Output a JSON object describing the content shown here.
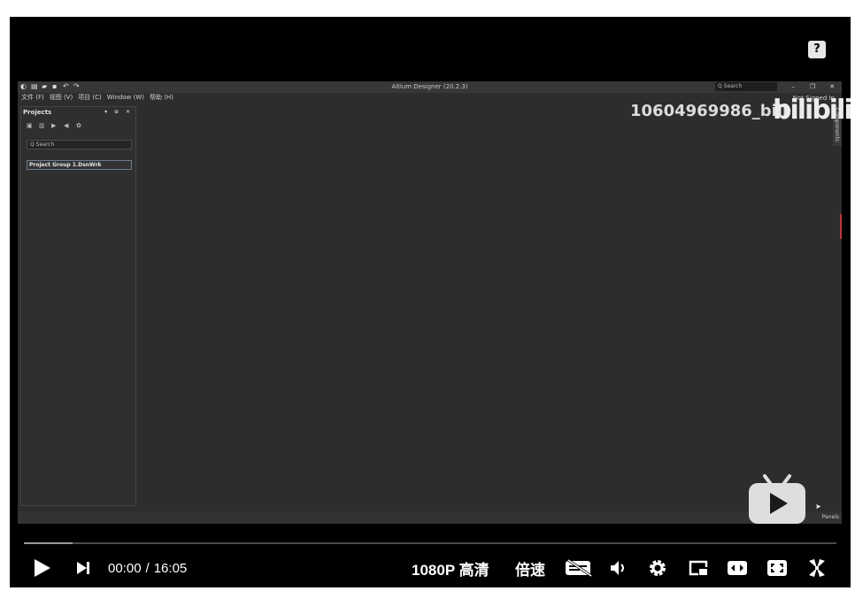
{
  "help_icon": "?",
  "altium": {
    "title": "Altium Designer (20.2.3)",
    "search_placeholder": "Q Search",
    "menu": [
      "文件 (F)",
      "视图 (V)",
      "项目 (C)",
      "Window (W)",
      "帮助 (H)"
    ],
    "signed_in": "Not Signed In",
    "projects_panel": {
      "title": "Projects",
      "search_placeholder": "Q Search",
      "item": "Project Group 1.DsnWrk"
    },
    "components_tab": "Components",
    "panels_button": "Panels"
  },
  "watermark": {
    "uid": "10604969986_bili",
    "brand": "bilibili"
  },
  "controls": {
    "progress": 0.06,
    "current_time": "00:00",
    "separator": "/",
    "duration": "16:05",
    "quality": "1080P 高清",
    "speed": "倍速"
  },
  "colors": {
    "player_bg": "#000000",
    "altium_bg": "#2d2d2d",
    "accent": "#c0343c"
  }
}
